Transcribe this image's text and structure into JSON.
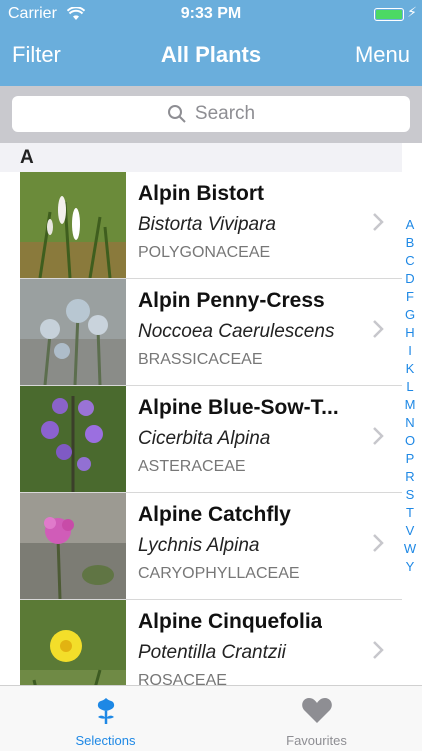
{
  "status": {
    "carrier": "Carrier",
    "time": "9:33 PM"
  },
  "nav": {
    "left": "Filter",
    "title": "All Plants",
    "right": "Menu"
  },
  "search": {
    "placeholder": "Search"
  },
  "section": "A",
  "plants": [
    {
      "name": "Alpin Bistort",
      "latin": "Bistorta Vivipara",
      "family": "POLYGONACEAE"
    },
    {
      "name": "Alpin Penny-Cress",
      "latin": "Noccoea Caerulescens",
      "family": "BRASSICACEAE"
    },
    {
      "name": "Alpine Blue-Sow-T...",
      "latin": "Cicerbita Alpina",
      "family": "ASTERACEAE"
    },
    {
      "name": "Alpine Catchfly",
      "latin": "Lychnis Alpina",
      "family": "CARYOPHYLLACEAE"
    },
    {
      "name": "Alpine Cinquefolia",
      "latin": "Potentilla Crantzii",
      "family": "ROSACEAE"
    }
  ],
  "index_letters": [
    "A",
    "B",
    "C",
    "D",
    "F",
    "G",
    "H",
    "I",
    "K",
    "L",
    "M",
    "N",
    "O",
    "P",
    "R",
    "S",
    "T",
    "V",
    "W",
    "Y"
  ],
  "tabs": {
    "selections": "Selections",
    "favourites": "Favourites"
  },
  "colors": {
    "nav_bg": "#6aaedc",
    "accent": "#1e88e5",
    "battery": "#4cd964"
  }
}
